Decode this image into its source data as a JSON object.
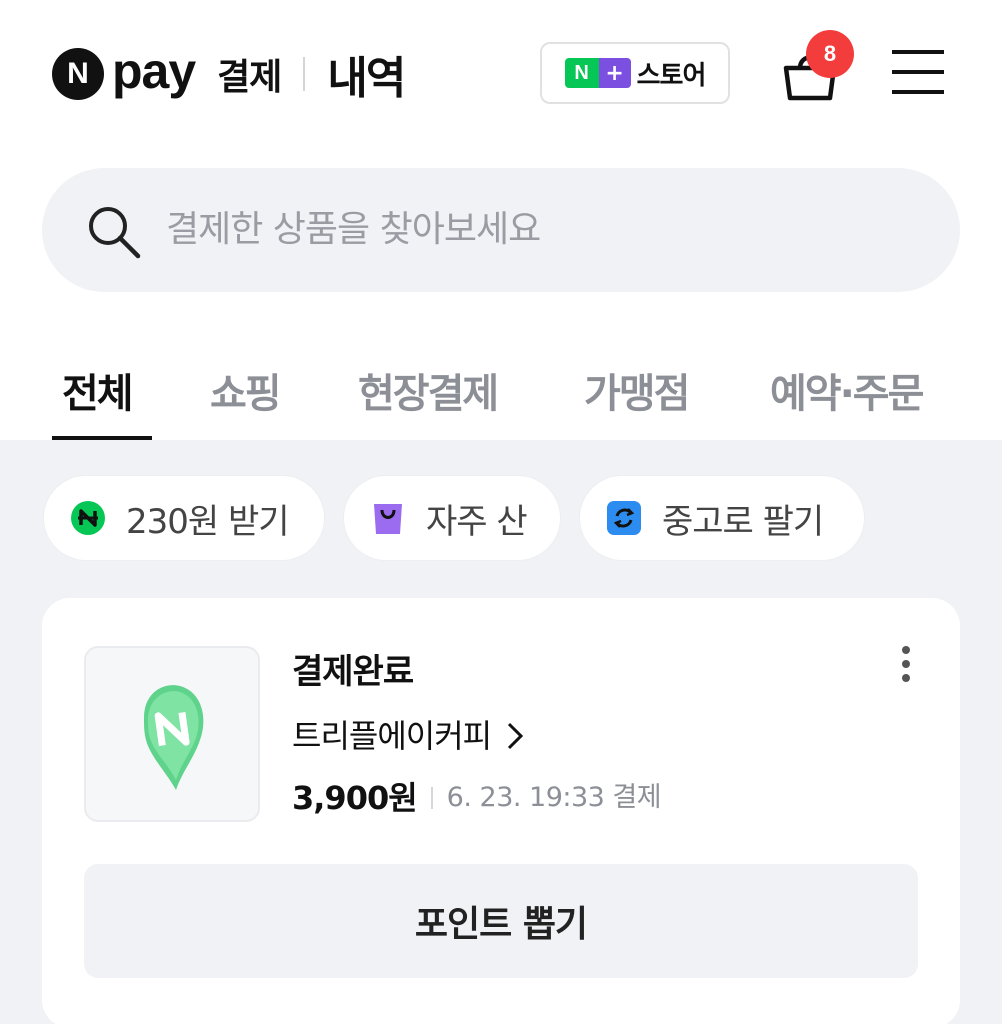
{
  "header": {
    "logo_n": "N",
    "logo_pay": "pay",
    "logo_sub": "결제",
    "logo_history": "내역",
    "store": {
      "n": "N",
      "plus": "+",
      "label": "스토어"
    },
    "cart_count": "8",
    "cart_icon": "shopping-bag-icon",
    "menu_icon": "hamburger-menu-icon"
  },
  "search": {
    "icon": "search-icon",
    "placeholder": "결제한 상품을 찾아보세요"
  },
  "tabs": [
    {
      "label": "전체",
      "active": true
    },
    {
      "label": "쇼핑",
      "active": false
    },
    {
      "label": "현장결제",
      "active": false
    },
    {
      "label": "가맹점",
      "active": false
    },
    {
      "label": "예약·주문",
      "active": false
    }
  ],
  "chips": [
    {
      "label": "230원 받기",
      "icon": "naverpay-point-icon",
      "color": "#06c755"
    },
    {
      "label": "자주 산",
      "icon": "shopping-bag-icon",
      "color": "#9b6cf0"
    },
    {
      "label": "중고로 팔기",
      "icon": "recycle-icon",
      "color": "#2d8cf0"
    }
  ],
  "order": {
    "status": "결제완료",
    "merchant": "트리플에이커피",
    "price": "3,900원",
    "paid_at": "6. 23. 19:33 결제",
    "thumb_icon": "naver-map-pin-icon",
    "point_button": "포인트 뽑기"
  },
  "colors": {
    "accent_green": "#06c755",
    "badge_red": "#f33c3c",
    "background_gray": "#f1f2f5"
  }
}
